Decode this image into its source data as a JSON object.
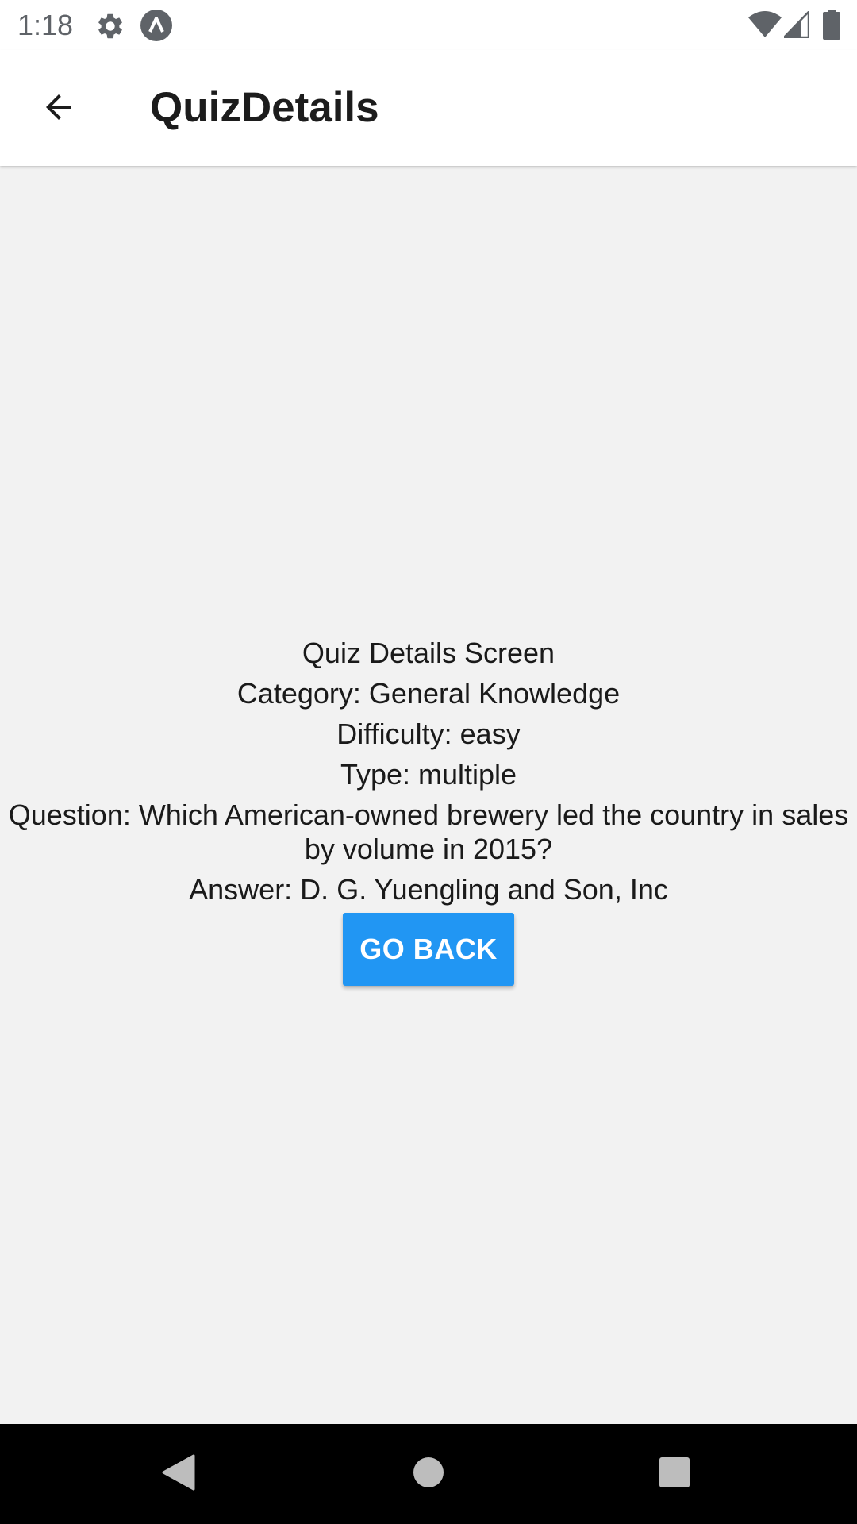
{
  "status_bar": {
    "time": "1:18",
    "icons": [
      "gear-icon",
      "app-notification-icon",
      "wifi-icon",
      "cell-signal-icon",
      "battery-icon"
    ]
  },
  "app_bar": {
    "title": "QuizDetails",
    "back_icon": "arrow-back-icon"
  },
  "content": {
    "heading": "Quiz Details Screen",
    "category": "Category: General Knowledge",
    "difficulty": "Difficulty: easy",
    "type": "Type: multiple",
    "question": "Question: Which American-owned brewery led the country in sales by volume in 2015?",
    "answer": "Answer: D. G. Yuengling and Son, Inc",
    "go_back_label": "GO BACK"
  },
  "nav_bar": {
    "icons": [
      "back-triangle-icon",
      "home-circle-icon",
      "recents-square-icon"
    ]
  },
  "colors": {
    "background": "#f2f2f2",
    "app_bar": "#ffffff",
    "accent": "#2196f3",
    "nav_bar": "#000000"
  }
}
